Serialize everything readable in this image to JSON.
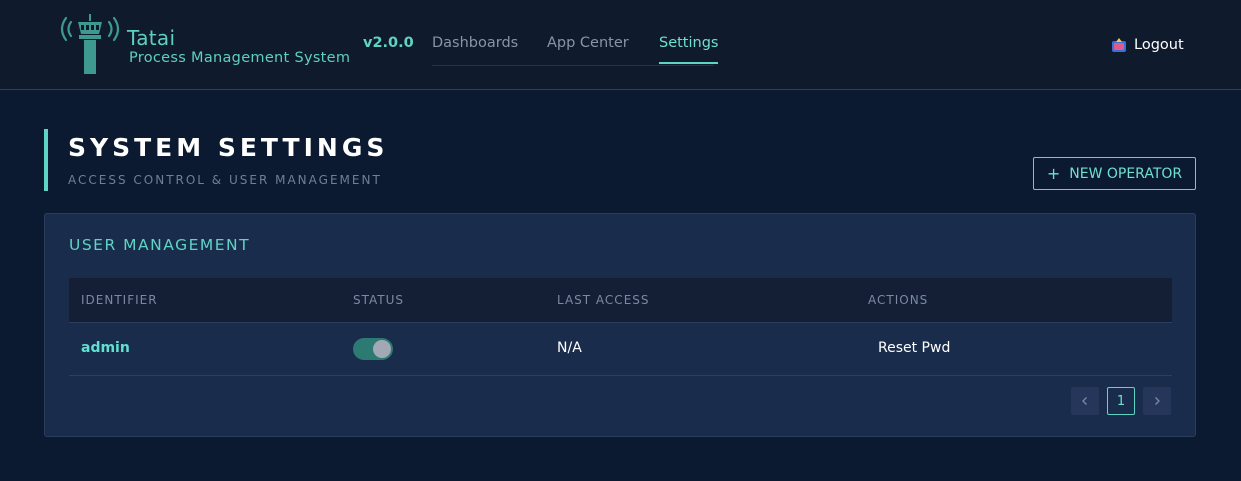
{
  "header": {
    "brand_name": "Tatai",
    "brand_subtitle": "Process Management System",
    "version": "v2.0.0",
    "nav": [
      {
        "label": "Dashboards",
        "active": false
      },
      {
        "label": "App Center",
        "active": false
      },
      {
        "label": "Settings",
        "active": true
      }
    ],
    "logout_label": "Logout"
  },
  "page": {
    "title": "SYSTEM SETTINGS",
    "subtitle": "ACCESS CONTROL & USER MANAGEMENT",
    "new_operator_label": "NEW OPERATOR"
  },
  "card": {
    "title": "USER MANAGEMENT",
    "columns": [
      "IDENTIFIER",
      "STATUS",
      "LAST ACCESS",
      "ACTIONS"
    ],
    "rows": [
      {
        "identifier": "admin",
        "status_enabled": true,
        "last_access": "N/A",
        "action": "Reset Pwd"
      }
    ],
    "pagination": {
      "current_page": "1",
      "prev_icon": "chevron-left-icon",
      "next_icon": "chevron-right-icon"
    }
  },
  "colors": {
    "accent": "#5fd4c4",
    "background": "#0b1a30",
    "header_bg": "#0f1a2c",
    "card_bg": "#1a2c4c"
  },
  "icons": {
    "logo": "control-tower-icon",
    "logout": "logout-icon",
    "new_operator": "plus-icon"
  }
}
